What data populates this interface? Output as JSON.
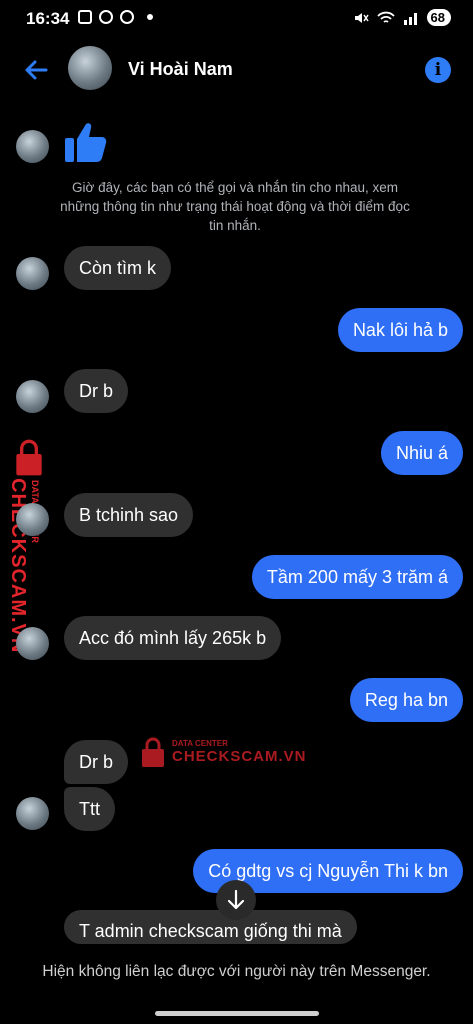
{
  "status_bar": {
    "time": "16:34",
    "battery": "68"
  },
  "header": {
    "contact_name": "Vi Hoài Nam"
  },
  "system_message": "Giờ đây, các bạn có thể gọi và nhắn tin cho nhau, xem những thông tin như trạng thái hoạt động và thời điểm đọc tin nhắn.",
  "messages": [
    {
      "from": "them",
      "text": "Còn tìm k"
    },
    {
      "from": "me",
      "text": "Nak lôi hả b"
    },
    {
      "from": "them",
      "text": "Dr b"
    },
    {
      "from": "me",
      "text": "Nhiu á"
    },
    {
      "from": "them",
      "text": "B tchinh sao"
    },
    {
      "from": "me",
      "text": "Tầm 200 mấy 3 trăm á"
    },
    {
      "from": "them",
      "text": "Acc đó mình lấy 265k b"
    },
    {
      "from": "me",
      "text": "Reg ha bn"
    },
    {
      "from": "them",
      "text": "Dr b"
    },
    {
      "from": "them",
      "text": "Ttt"
    },
    {
      "from": "me",
      "text": "Có gdtg vs cj Nguyễn Thi k bn"
    },
    {
      "from": "them",
      "text": "T admin checkscam giống thi mà"
    }
  ],
  "watermark": {
    "brand": "CHECKSCAM.VN",
    "tag": "DATA CENTER"
  },
  "footer": {
    "notice": "Hiện không liên lạc được với người này trên Messenger."
  },
  "colors": {
    "outgoing": "#2f6ff6",
    "incoming": "#303030",
    "accent": "#2e7cf6",
    "watermark": "#e2252b"
  }
}
